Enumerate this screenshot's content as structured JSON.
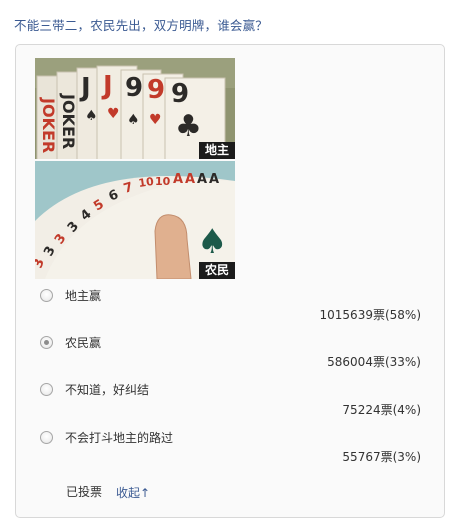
{
  "question": "不能三带二，农民先出，双方明牌，谁会赢？",
  "images": [
    {
      "tag": "地主",
      "cards": [
        "JOKER",
        "JOKER",
        "J",
        "J",
        "9",
        "9",
        "9"
      ]
    },
    {
      "tag": "农民",
      "cards": [
        "3",
        "3",
        "3",
        "3",
        "4",
        "5",
        "6",
        "7",
        "10",
        "10",
        "A",
        "A",
        "A",
        "A"
      ]
    }
  ],
  "options": [
    {
      "label": "地主赢",
      "count": "1015639票(58%)",
      "checked": false
    },
    {
      "label": "农民赢",
      "count": "586004票(33%)",
      "checked": true
    },
    {
      "label": "不知道，好纠结",
      "count": "75224票(4%)",
      "checked": false
    },
    {
      "label": "不会打斗地主的路过",
      "count": "55767票(3%)",
      "checked": false
    }
  ],
  "footer": {
    "voted": "已投票",
    "collapse": "收起↑"
  }
}
